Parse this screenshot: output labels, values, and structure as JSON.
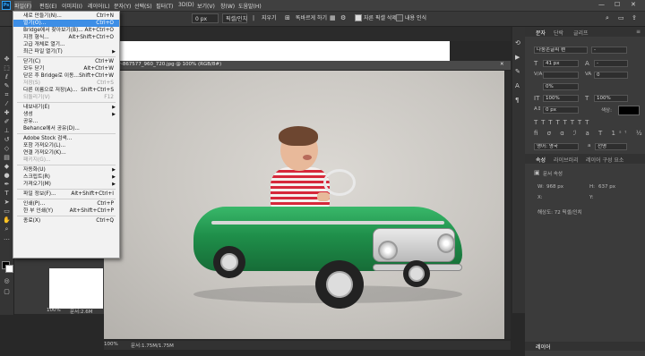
{
  "app": {
    "icon_text": "Ps"
  },
  "menubar": {
    "items": [
      "파일(F)",
      "편집(E)",
      "이미지(I)",
      "레이어(L)",
      "문자(Y)",
      "선택(S)",
      "필터(T)",
      "3D(D)",
      "보기(V)",
      "창(W)",
      "도움말(H)"
    ],
    "window_controls": [
      "—",
      "☐",
      "✕"
    ]
  },
  "options_bar": {
    "feather_value": "0 px",
    "zoom_label": "픽셀/인치",
    "clear_button": "지우기",
    "straighten_label": "똑바르게 하기",
    "delete_pixels_label": "자른 픽셀 삭제",
    "content_aware_label": "내용 인식"
  },
  "file_menu": {
    "items": [
      {
        "label": "새로 만들기(N)...",
        "shortcut": "Ctrl+N",
        "state": "normal"
      },
      {
        "label": "열기(O)...",
        "shortcut": "Ctrl+O",
        "state": "highlighted"
      },
      {
        "label": "Bridge에서 찾아보기(B)...",
        "shortcut": "Alt+Ctrl+O",
        "state": "normal"
      },
      {
        "label": "지정 형식...",
        "shortcut": "Alt+Shift+Ctrl+O",
        "state": "normal"
      },
      {
        "label": "고급 개체로 열기...",
        "shortcut": "",
        "state": "normal"
      },
      {
        "label": "최근 파일 열기(T)",
        "shortcut": "",
        "state": "submenu"
      },
      {
        "sep": true
      },
      {
        "label": "닫기(C)",
        "shortcut": "Ctrl+W",
        "state": "normal"
      },
      {
        "label": "모두 닫기",
        "shortcut": "Alt+Ctrl+W",
        "state": "normal"
      },
      {
        "label": "닫은 후 Bridge로 이동...",
        "shortcut": "Shift+Ctrl+W",
        "state": "normal"
      },
      {
        "label": "저장(S)",
        "shortcut": "Ctrl+S",
        "state": "disabled"
      },
      {
        "label": "다른 이름으로 저장(A)...",
        "shortcut": "Shift+Ctrl+S",
        "state": "normal"
      },
      {
        "label": "되돌리기(V)",
        "shortcut": "F12",
        "state": "disabled"
      },
      {
        "sep": true
      },
      {
        "label": "내보내기(E)",
        "shortcut": "",
        "state": "submenu"
      },
      {
        "label": "생성",
        "shortcut": "",
        "state": "submenu"
      },
      {
        "label": "공유...",
        "shortcut": "",
        "state": "normal"
      },
      {
        "label": "Behance에서 공유(D)...",
        "shortcut": "",
        "state": "normal"
      },
      {
        "sep": true
      },
      {
        "label": "Adobe Stock 검색...",
        "shortcut": "",
        "state": "normal"
      },
      {
        "label": "포함 가져오기(L)...",
        "shortcut": "",
        "state": "normal"
      },
      {
        "label": "연결 가져오기(K)...",
        "shortcut": "",
        "state": "normal"
      },
      {
        "label": "패키지(G)...",
        "shortcut": "",
        "state": "disabled"
      },
      {
        "sep": true
      },
      {
        "label": "자동화(U)",
        "shortcut": "",
        "state": "submenu"
      },
      {
        "label": "스크립트(R)",
        "shortcut": "",
        "state": "submenu"
      },
      {
        "label": "가져오기(M)",
        "shortcut": "",
        "state": "submenu"
      },
      {
        "sep": true
      },
      {
        "label": "파일 정보(F)...",
        "shortcut": "Alt+Shift+Ctrl+I",
        "state": "normal"
      },
      {
        "sep": true
      },
      {
        "label": "인쇄(P)...",
        "shortcut": "Ctrl+P",
        "state": "normal"
      },
      {
        "label": "한 부 인쇄(Y)",
        "shortcut": "Alt+Shift+Ctrl+P",
        "state": "normal"
      },
      {
        "sep": true
      },
      {
        "label": "종료(X)",
        "shortcut": "Ctrl+Q",
        "state": "normal"
      }
    ]
  },
  "document": {
    "tab_title": "driver-867577_960_720.jpg @ 100% (RGB/8#)",
    "tab_close": "✕",
    "zoom": "100%",
    "doc_info": "문서:1.75M/1.75M"
  },
  "second_document": {
    "zoom": "100%",
    "doc_info": "문서:2.6M"
  },
  "character_panel": {
    "tabs": [
      "문자",
      "단락",
      "글리프"
    ],
    "font_family": "나눔손글씨 펜",
    "font_style": "-",
    "font_size": "41 px",
    "leading": "-",
    "kerning": "",
    "tracking": "0",
    "tracking_pct": "0%",
    "vscale": "100%",
    "hscale": "100%",
    "baseline": "0 px",
    "color_label": "색상:",
    "language": "영어: 영국",
    "anti_alias": "선명",
    "aa_icon_label": "a"
  },
  "properties_panel": {
    "tabs": [
      "속성",
      "라이브러리",
      "레이어 구성 요소"
    ],
    "doc_label": "문서 속성",
    "width_label": "W:",
    "width_value": "968 px",
    "height_label": "H:",
    "height_value": "637 px",
    "x_label": "X:",
    "y_label": "Y:",
    "resolution": "해상도: 72 픽셀/인치"
  },
  "layers_panel": {
    "title": "레이어"
  },
  "colors": {
    "menu_highlight": "#3d8ee6",
    "car_green": "#1f8f4a",
    "app_bg": "#282828"
  }
}
